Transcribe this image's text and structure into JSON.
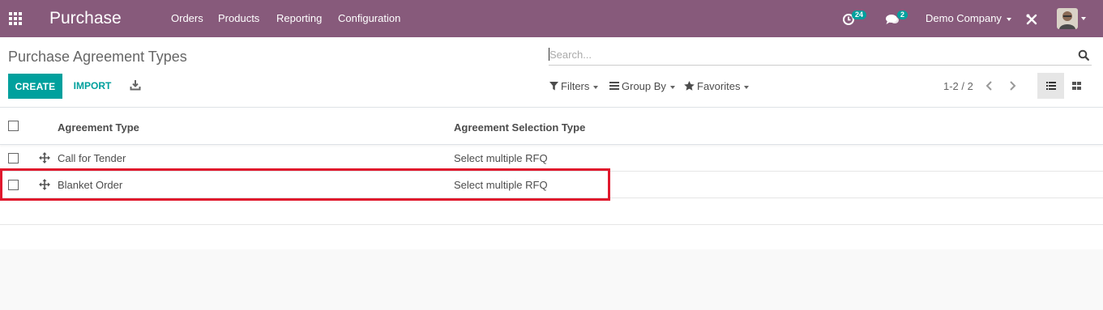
{
  "navbar": {
    "brand": "Purchase",
    "menu": [
      "Orders",
      "Products",
      "Reporting",
      "Configuration"
    ],
    "activity_count": "24",
    "message_count": "2",
    "company": "Demo Company"
  },
  "page": {
    "title": "Purchase Agreement Types"
  },
  "search": {
    "placeholder": "Search..."
  },
  "toolbar": {
    "create_label": "CREATE",
    "import_label": "IMPORT",
    "filters_label": "Filters",
    "group_by_label": "Group By",
    "favorites_label": "Favorites"
  },
  "pager": {
    "value": "1-2 / 2"
  },
  "table": {
    "headers": [
      "Agreement Type",
      "Agreement Selection Type"
    ],
    "rows": [
      {
        "agreement_type": "Call for Tender",
        "selection_type": "Select multiple RFQ"
      },
      {
        "agreement_type": "Blanket Order",
        "selection_type": "Select multiple RFQ"
      }
    ]
  },
  "colors": {
    "navbar": "#875a7b",
    "primary": "#00a09d",
    "highlight": "#e0182d"
  },
  "icons": [
    "apps-grid-icon",
    "activity-clock-icon",
    "chat-icon",
    "debug-tools-icon",
    "user-avatar",
    "search-icon",
    "download-icon",
    "filter-icon",
    "group-by-icon",
    "star-icon",
    "chevron-left-icon",
    "chevron-right-icon",
    "list-view-icon",
    "kanban-view-icon",
    "drag-handle-icon"
  ]
}
